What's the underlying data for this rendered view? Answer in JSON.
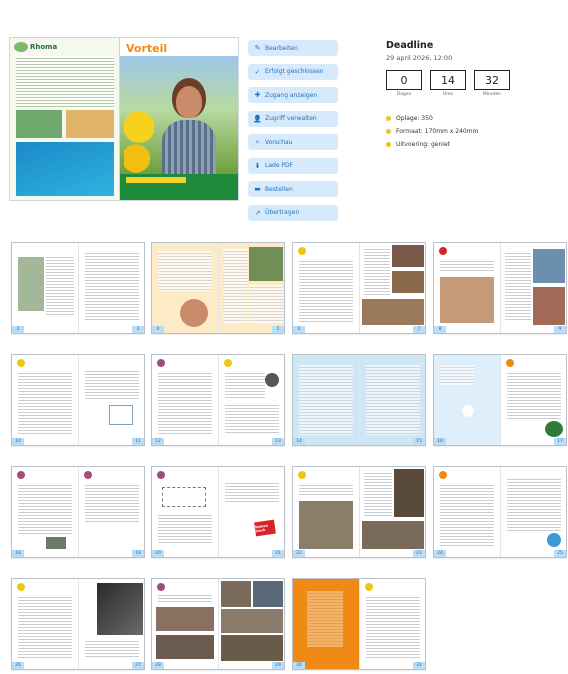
{
  "cover": {
    "back_title": "Rhoma",
    "front_title": "Vorteil"
  },
  "actions": [
    {
      "label": "Bearbeiten",
      "icon": "✎",
      "icon_name": "pencil-icon"
    },
    {
      "label": "Erfolgt geschlossen",
      "icon": "✓",
      "icon_name": "check-icon"
    },
    {
      "label": "Zugang anzeigen",
      "icon": "✚",
      "icon_name": "plus-icon"
    },
    {
      "label": "Zugriff verwalten",
      "icon": "👤",
      "icon_name": "user-icon"
    },
    {
      "label": "Vorschau",
      "icon": "⌕",
      "icon_name": "preview-icon"
    },
    {
      "label": "Lade PDF",
      "icon": "⬇",
      "icon_name": "download-icon"
    },
    {
      "label": "Bestellen",
      "icon": "▬",
      "icon_name": "order-icon"
    },
    {
      "label": "Übertragen",
      "icon": "↗",
      "icon_name": "share-icon"
    }
  ],
  "deadline": {
    "title": "Deadline",
    "date": "29 april 2026, 12:00",
    "countdown": [
      {
        "value": "0",
        "label": "Dagen"
      },
      {
        "value": "14",
        "label": "Uren"
      },
      {
        "value": "32",
        "label": "Minuten"
      }
    ],
    "specs": [
      {
        "text": "Oplage: 350"
      },
      {
        "text": "Formaat: 170mm x 240mm"
      },
      {
        "text": "Uitvoering: geniet"
      }
    ]
  },
  "spreads": [
    {
      "left": "2",
      "right": "3"
    },
    {
      "left": "4",
      "right": "5"
    },
    {
      "left": "6",
      "right": "7"
    },
    {
      "left": "8",
      "right": "9"
    },
    {
      "left": "10",
      "right": "11"
    },
    {
      "left": "12",
      "right": "13"
    },
    {
      "left": "14",
      "right": "15"
    },
    {
      "left": "16",
      "right": "17"
    },
    {
      "left": "18",
      "right": "19"
    },
    {
      "left": "20",
      "right": "21"
    },
    {
      "left": "22",
      "right": "23"
    },
    {
      "left": "24",
      "right": "25"
    },
    {
      "left": "26",
      "right": "27"
    },
    {
      "left": "28",
      "right": "29"
    },
    {
      "left": "30",
      "right": "31"
    }
  ],
  "badge_text": "Samen sterk",
  "colors": {
    "button_bg": "#d6eafb",
    "button_text": "#1e73c2",
    "spec_bullet": "#f0c419",
    "page_number_bg": "#b9dcf7",
    "cover_title": "#f18a14"
  }
}
